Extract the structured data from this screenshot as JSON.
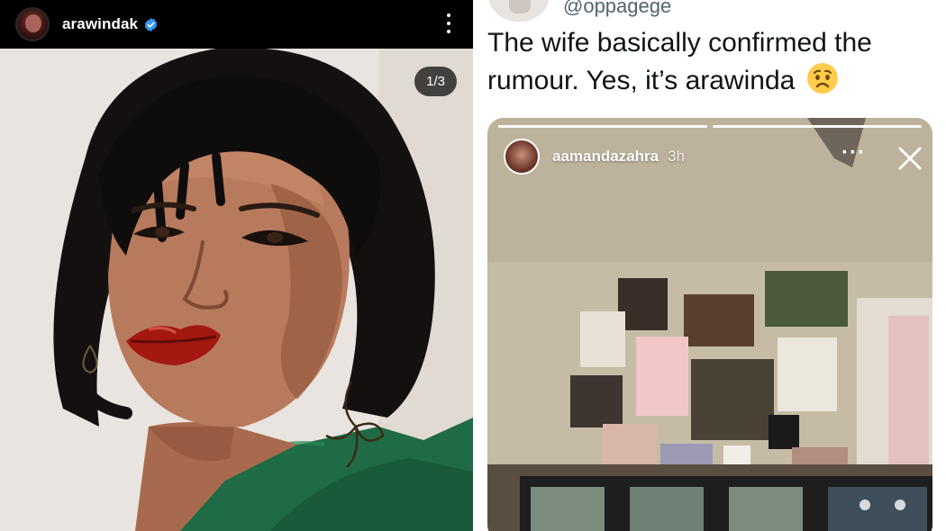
{
  "instagram_post": {
    "username": "arawindak",
    "verified_icon": "verified-badge-icon",
    "more_icon": "more-vertical-icon",
    "carousel_counter": "1/3",
    "accent_color": "#3897f0"
  },
  "tweet": {
    "handle": "@oppagege",
    "text": "The wife basically confirmed the rumour. Yes, it’s arawinda",
    "emoji_icon": "worried-face-emoji",
    "story": {
      "username": "aamandazahra",
      "time": "3h",
      "more_icon": "more-horizontal-icon",
      "close_icon": "close-icon"
    }
  }
}
